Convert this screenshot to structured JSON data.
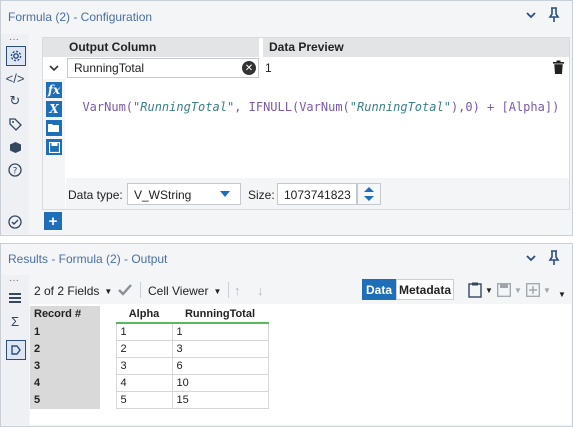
{
  "config_panel": {
    "title": "Formula (2) - Configuration",
    "columns": {
      "output": "Output Column",
      "preview": "Data Preview"
    },
    "row": {
      "output_value": "RunningTotal",
      "preview_value": "1"
    },
    "expression": {
      "fn1": "VarNum(",
      "str1": "\"RunningTotal\"",
      "mid": ", IFNULL(VarNum(",
      "str2": "\"RunningTotal\"",
      "end": "),0) + [Alpha])"
    },
    "data_type_label": "Data type:",
    "data_type_value": "V_WString",
    "size_label": "Size:",
    "size_value": "1073741823"
  },
  "results_panel": {
    "title": "Results - Formula (2) - Output",
    "fields_label": "2 of 2 Fields",
    "cell_viewer_label": "Cell Viewer",
    "tab_data": "Data",
    "tab_metadata": "Metadata"
  },
  "table": {
    "headers": [
      "Record #",
      "Alpha",
      "RunningTotal"
    ],
    "rows": [
      [
        "1",
        "1",
        "1"
      ],
      [
        "2",
        "2",
        "3"
      ],
      [
        "3",
        "3",
        "6"
      ],
      [
        "4",
        "4",
        "10"
      ],
      [
        "5",
        "5",
        "15"
      ]
    ]
  },
  "icons": {
    "settings": "gear-icon",
    "code": "code-icon",
    "tag": "tag-icon",
    "cube": "cube-icon",
    "help": "help-icon",
    "pin": "pin-icon",
    "chevron": "chevron-down-icon",
    "trash": "trash-icon"
  },
  "colors": {
    "accent": "#1f6fb8",
    "header_bg": "#e9eaec",
    "active_tab": "#1f6fb8",
    "green": "#5cb85c"
  }
}
